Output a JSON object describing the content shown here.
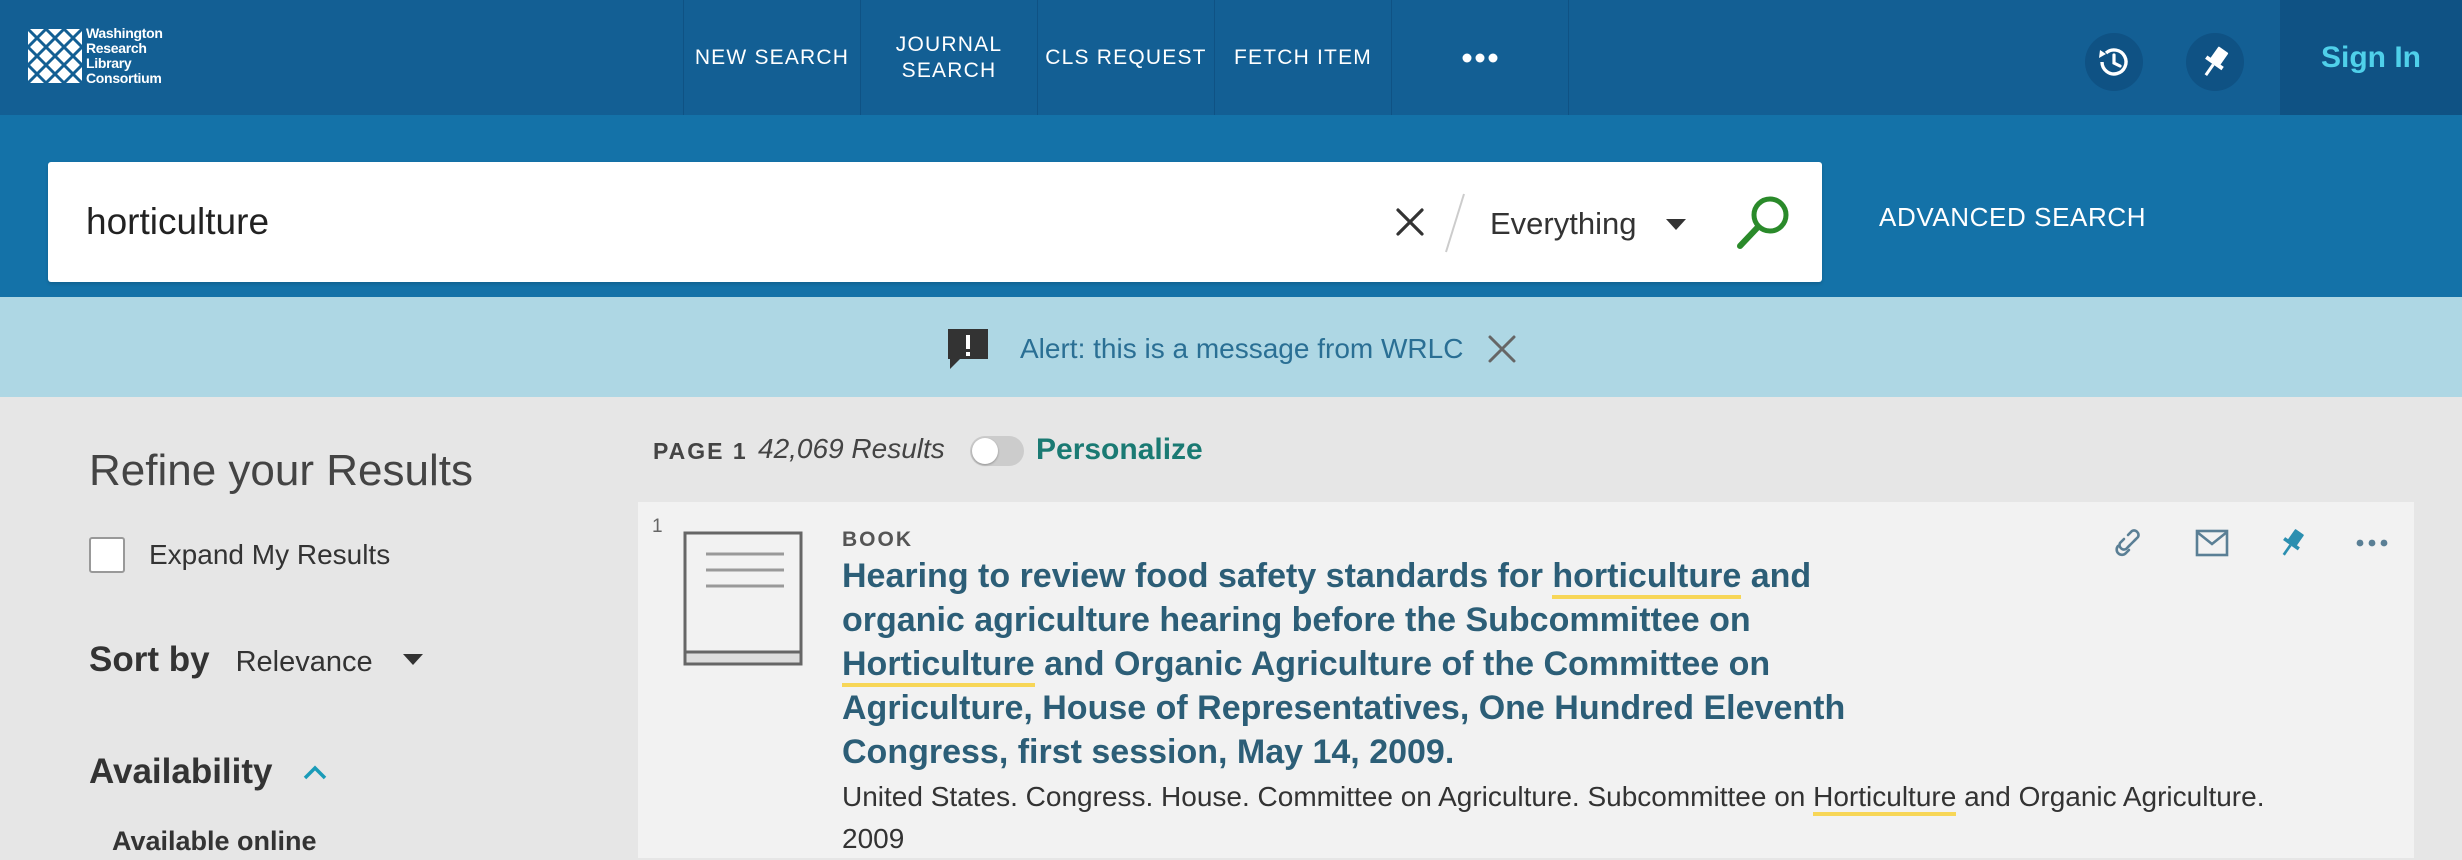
{
  "brand": {
    "logo_lines": [
      "Washington",
      "Research",
      "Library",
      "Consortium"
    ]
  },
  "nav": {
    "items": [
      {
        "label": "NEW SEARCH"
      },
      {
        "label": "JOURNAL\nSEARCH"
      },
      {
        "label": "CLS REQUEST"
      },
      {
        "label": "FETCH ITEM"
      }
    ],
    "more_icon": "ellipsis-icon",
    "sign_in": "Sign In"
  },
  "search": {
    "query": "horticulture",
    "scope": "Everything",
    "advanced": "ADVANCED SEARCH"
  },
  "alert": {
    "text": "Alert: this is a message from WRLC"
  },
  "sidebar": {
    "refine_title": "Refine your Results",
    "expand_label": "Expand My Results",
    "sort_label": "Sort by",
    "sort_value": "Relevance",
    "availability_label": "Availability",
    "available_online": "Available online"
  },
  "results": {
    "page_label": "PAGE 1",
    "count": "42,069 Results",
    "personalize": "Personalize",
    "items": [
      {
        "number": "1",
        "type": "BOOK",
        "title_parts": [
          "Hearing to review food safety standards for ",
          "horticulture",
          " and organic agriculture hearing before the Subcommittee on ",
          "Horticulture",
          " and Organic Agriculture of the Committee on Agriculture, House of Representatives, One Hundred Eleventh Congress, first session, May 14, 2009."
        ],
        "creator_parts": [
          "United States. Congress. House. Committee on Agriculture. Subcommittee on ",
          "Horticulture",
          " and Organic Agriculture."
        ],
        "year": "2009"
      }
    ]
  },
  "colors": {
    "topbar": "#135f94",
    "searchband": "#1472a8",
    "alertband": "#aed7e4",
    "accent_teal": "#1a7a73",
    "sign_in": "#4fd0ea",
    "highlight": "#f7d657",
    "search_icon": "#2a8a2a"
  }
}
